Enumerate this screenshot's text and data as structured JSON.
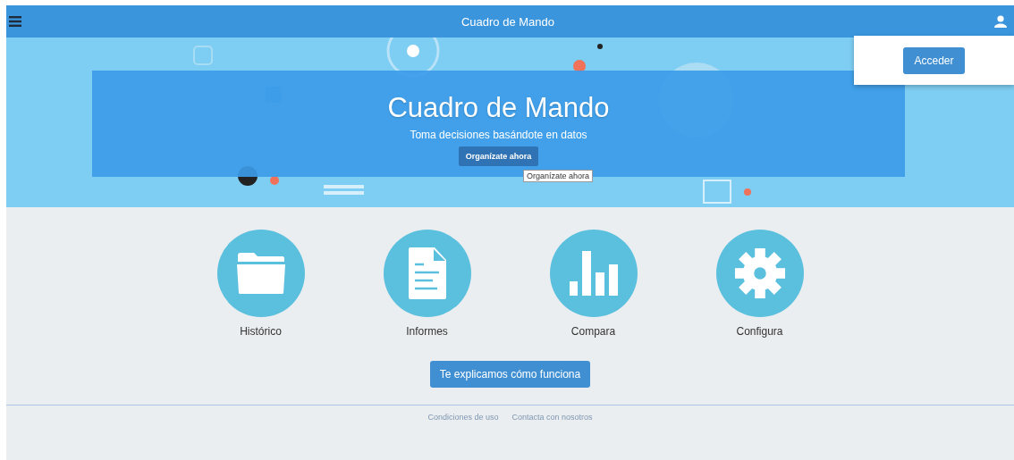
{
  "header": {
    "title": "Cuadro de Mando"
  },
  "user_menu": {
    "button": "Acceder"
  },
  "hero": {
    "title": "Cuadro de Mando",
    "subtitle": "Toma decisiones basándote en datos",
    "button": "Organízate ahora",
    "tooltip": "Organízate ahora"
  },
  "tiles": [
    {
      "kind": "folder",
      "label": "Histórico"
    },
    {
      "kind": "document",
      "label": "Informes"
    },
    {
      "kind": "chart",
      "label": "Compara"
    },
    {
      "kind": "gear",
      "label": "Configura"
    }
  ],
  "help_button": "Te explicamos cómo funciona",
  "footer_links": [
    "Condiciones de uso",
    "Contacta con nosotros"
  ]
}
